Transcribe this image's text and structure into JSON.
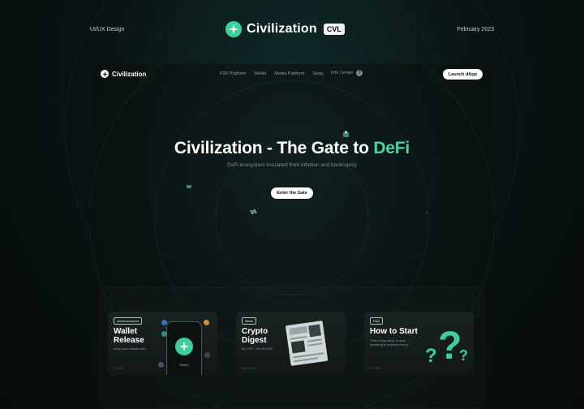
{
  "header": {
    "left_label": "UI/UX Design",
    "brand_name": "Civilization",
    "brand_badge": "CVL",
    "right_label": "February 2023"
  },
  "nav": {
    "brand_name": "Civilization",
    "links": [
      "P2P Platform",
      "Wallet",
      "Media Platform",
      "Swap"
    ],
    "info_label": "Info Center",
    "info_icon": "?",
    "launch_label": "Launch dApp"
  },
  "hero": {
    "title_main": "Civilization - The Gate to ",
    "title_accent": "DeFi",
    "subtitle": "DeFi ecosystem insulated from inflation and bankruptcy",
    "cta_label": "Enter the Gate"
  },
  "cards": [
    {
      "tag": "Announcement",
      "title": "Wallet Release",
      "desc": "Keep your assets safe",
      "date": "02.2023",
      "phone_label": "Wallet"
    },
    {
      "tag": "News",
      "title": "Crypto Digest",
      "desc": "By CVR · 28.09.2022",
      "date": "28.09.2022"
    },
    {
      "tag": "FAQ",
      "title": "How to Start",
      "desc": "Three easy steps to start investing in cryptocurrency",
      "date": "02.2023"
    }
  ],
  "colors": {
    "accent": "#4fd3a0",
    "background": "#0a1414",
    "panel": "#121818"
  },
  "icons": {
    "brand": "civilization-star-icon",
    "info": "question-icon",
    "news": "newspaper-icon",
    "faq": "question-marks-icon"
  }
}
